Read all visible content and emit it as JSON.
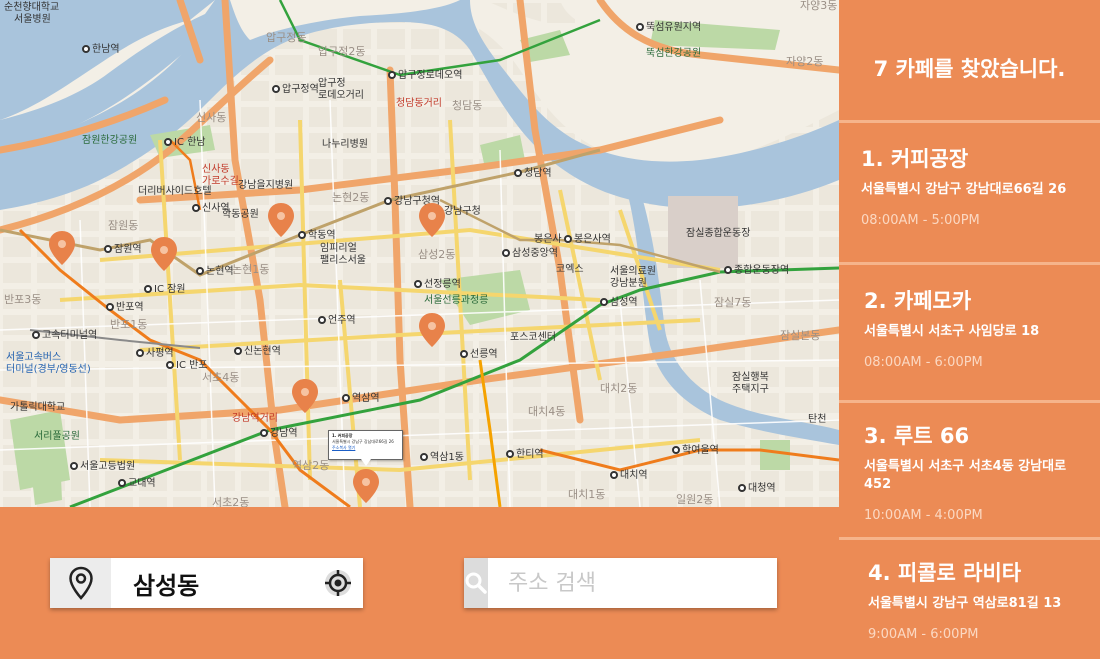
{
  "header": {
    "result_count": "7 카페를 찾았습니다."
  },
  "cafes": [
    {
      "name": "1. 커피공장",
      "address": "서울특별시 강남구 강남대로66길 26",
      "hours": "08:00AM - 5:00PM"
    },
    {
      "name": "2. 카페모카",
      "address": "서울특별시 서초구 사임당로 18",
      "hours": "08:00AM - 6:00PM"
    },
    {
      "name": "3. 루트 66",
      "address": "서울특별시 서초구 서초4동 강남대로 452",
      "hours": "10:00AM - 4:00PM"
    },
    {
      "name": "4. 피콜로 라비타",
      "address": "서울특별시 강남구 역삼로81길 13",
      "hours": "9:00AM - 6:00PM"
    }
  ],
  "location": {
    "value": "삼성동",
    "icon": "map-pin-icon",
    "gps_icon": "crosshair-icon"
  },
  "search": {
    "placeholder": "주소 검색",
    "icon": "search-icon"
  },
  "popup": {
    "title": "1. 커피공장",
    "address": "서울특별시 강남구 강남대로66길 26",
    "link": "주소복사 열기"
  },
  "map": {
    "labels": [
      "순천향대학교",
      "서울병원",
      "한남역",
      "압구정동",
      "압구정2동",
      "압구정로데오역",
      "뚝섬유원지역",
      "자양3동",
      "뚝섬한강공원",
      "자양2동",
      "압구정역",
      "압구정 로데오거리",
      "청담동거리",
      "청담동",
      "잠원한강공원",
      "IC 한남",
      "신사동",
      "나누리병원",
      "신사동 가로수길",
      "강남을지병원",
      "더리버사이드호텔",
      "신사역",
      "학동공원",
      "논현2동",
      "강남구청역",
      "강남구청",
      "청담역",
      "잠원동",
      "잠원역",
      "학동역",
      "임피리얼 팰리스서울",
      "삼성2동",
      "삼성중앙역",
      "봉은사",
      "봉은사역",
      "잠실종합운동장",
      "코엑스",
      "서울의료원 강남분원",
      "종합운동장역",
      "논현역",
      "논현1동",
      "선정릉역",
      "서울선릉과정릉",
      "삼성역",
      "잠실7동",
      "반포3동",
      "IC 잠원",
      "반포역",
      "반포1동",
      "언주역",
      "포스코센터",
      "잠실본동",
      "고속터미널역",
      "사평역",
      "신논현역",
      "선릉역",
      "서울고속버스 터미널(경부/영동선)",
      "IC 반포",
      "서초4동",
      "잠실행복 주택지구",
      "역삼역",
      "대치2동",
      "가톨릭대학교",
      "강남역거리",
      "대치4동",
      "서리풀공원",
      "강남역",
      "학여울역",
      "서울고등법원",
      "역삼2동",
      "역삼1동",
      "한티역",
      "대치역",
      "교대역",
      "대치1동",
      "일원2동",
      "대청역",
      "서초2동",
      "탄천"
    ],
    "colors": {
      "water": "#a9c4dc",
      "park": "#bcd9a6",
      "line2": "#33a23d",
      "line3": "#ef7c1c",
      "line9": "#bfa26a",
      "bundang": "#f5a200",
      "pin": "#e8824a"
    }
  }
}
